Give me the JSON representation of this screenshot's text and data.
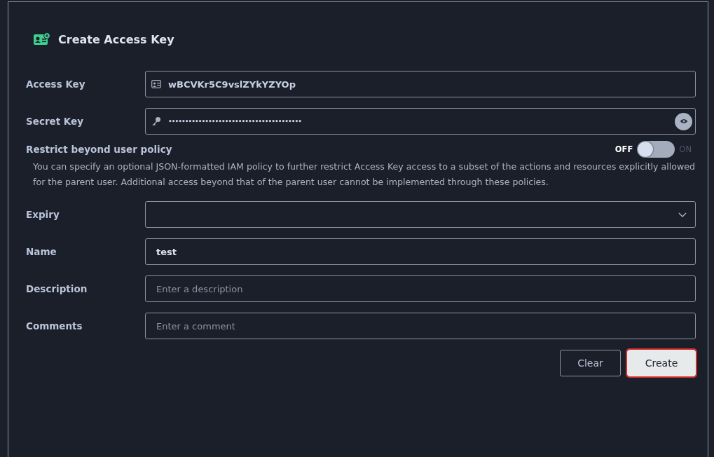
{
  "dialog": {
    "title": "Create Access Key"
  },
  "fields_top": [
    {
      "kind": "text",
      "label": "Access Key",
      "value": "wBCVKr5C9vslZYkYZYOp"
    },
    {
      "kind": "password",
      "label": "Secret Key",
      "value": "••••••••••••••••••••••••••••••••••••••••"
    }
  ],
  "restrict": {
    "label": "Restrict beyond user policy",
    "off_label": "OFF",
    "on_label": "ON",
    "on": false,
    "description": "You can specify an optional JSON-formatted IAM policy to further restrict Access Key access to a subset of the actions and resources explicitly allowed for the parent user. Additional access beyond that of the parent user cannot be implemented through these policies."
  },
  "fields": [
    {
      "kind": "select",
      "label": "Expiry"
    },
    {
      "kind": "text",
      "label": "Name",
      "value": "test"
    },
    {
      "kind": "text",
      "label": "Description",
      "placeholder": "Enter a description"
    },
    {
      "kind": "text",
      "label": "Comments",
      "placeholder": "Enter a comment"
    }
  ],
  "buttons": [
    {
      "label": "Clear",
      "kind": "secondary",
      "highlighted": false
    },
    {
      "label": "Create",
      "kind": "primary",
      "highlighted": true
    }
  ]
}
